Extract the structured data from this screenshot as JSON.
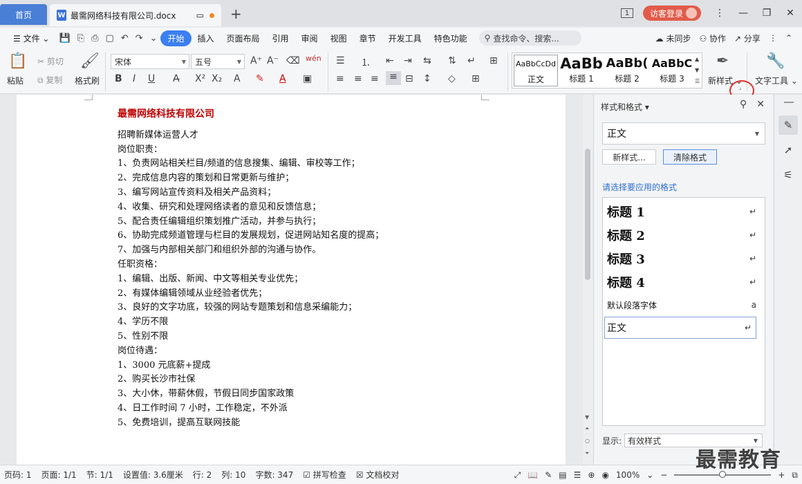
{
  "titlebar": {
    "home_tab": "首页",
    "doc_tab": "最需网络科技有限公司.docx",
    "doc_icon": "W",
    "badge": "1",
    "login": "访客登录",
    "add_tab": "+",
    "min": "—",
    "restore": "❐",
    "close": "✕"
  },
  "menubar": {
    "file": "文件",
    "tabs": [
      "开始",
      "插入",
      "页面布局",
      "引用",
      "审阅",
      "视图",
      "章节",
      "开发工具",
      "特色功能"
    ],
    "search": "查找命令、搜索...",
    "sync": "未同步",
    "collab": "协作",
    "share": "分享"
  },
  "ribbon": {
    "paste": "粘贴",
    "cut": "剪切",
    "copy": "复制",
    "format_painter": "格式刷",
    "font_name": "宋体",
    "font_size": "五号",
    "styles": [
      {
        "sample": "AaBbCcDd",
        "label": "正文"
      },
      {
        "sample": "AaBb",
        "label": "标题 1"
      },
      {
        "sample": "AaBb(",
        "label": "标题 2"
      },
      {
        "sample": "AaBbC",
        "label": "标题 3"
      }
    ],
    "new_style": "新样式",
    "text_tools": "文字工具"
  },
  "document": {
    "title": "最需网络科技有限公司",
    "lines": [
      "招聘新媒体运营人才",
      "岗位职责：",
      "1、负责网站相关栏目/频道的信息搜集、编辑、审校等工作；",
      "2、完成信息内容的策划和日常更新与维护；",
      "3、编写网站宣传资料及相关产品资料；",
      "4、收集、研究和处理网络读者的意见和反馈信息；",
      "5、配合责任编辑组织策划推广活动，并参与执行；",
      "6、协助完成频道管理与栏目的发展规划，促进网站知名度的提高；",
      "7、加强与内部相关部门和组织外部的沟通与协作。",
      "任职资格：",
      "1、编辑、出版、新闻、中文等相关专业优先；",
      "2、有媒体编辑领域从业经验者优先；",
      "3、良好的文字功底，较强的网站专题策划和信息采编能力；",
      "4、学历不限",
      "5、性别不限",
      "岗位待遇：",
      "1、3000 元底薪+提成",
      "2、购买长沙市社保",
      "3、大小休，带薪休假，节假日同步国家政策",
      "4、日工作时间 7 小时，工作稳定，不外派",
      "5、免费培训，提高互联网技能"
    ]
  },
  "pane": {
    "title": "样式和格式",
    "current_style": "正文",
    "new_style_btn": "新样式...",
    "clear_btn": "清除格式",
    "apply_label": "请选择要应用的格式",
    "items": [
      {
        "text": "标题  1",
        "mark": "↵"
      },
      {
        "text": "标题  2",
        "mark": "↵"
      },
      {
        "text": "标题  3",
        "mark": "↵"
      },
      {
        "text": "标题  4",
        "mark": "↵"
      },
      {
        "text": "默认段落字体",
        "mark": "a"
      },
      {
        "text": "正文",
        "mark": "↵"
      }
    ],
    "show_label": "显示:",
    "show_value": "有效样式"
  },
  "statusbar": {
    "page_code": "页码: 1",
    "page": "页面: 1/1",
    "section": "节: 1/1",
    "setting": "设置值: 3.6厘米",
    "row": "行: 2",
    "col": "列: 10",
    "words": "字数: 347",
    "spell": "拼写检查",
    "proof": "文档校对",
    "zoom": "100%",
    "zoom_level": 0.5
  },
  "watermark": "最需教育"
}
